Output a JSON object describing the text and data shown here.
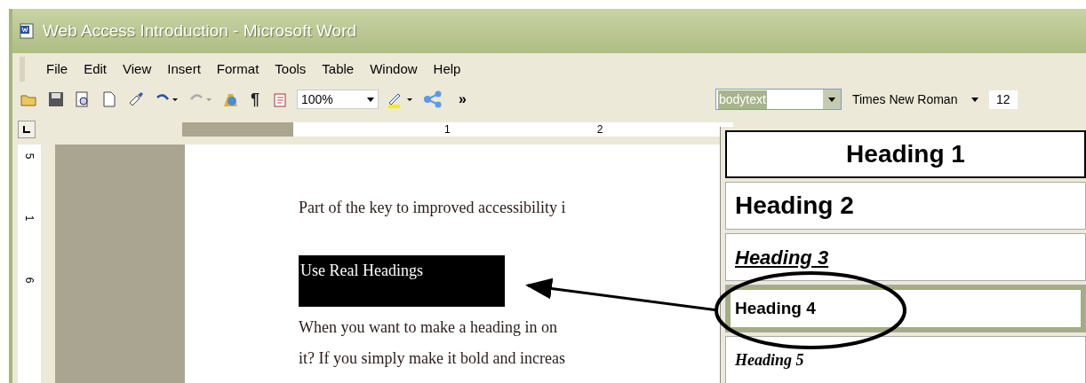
{
  "window": {
    "title": "Web Access Introduction - Microsoft Word"
  },
  "menu": [
    "File",
    "Edit",
    "View",
    "Insert",
    "Format",
    "Tools",
    "Table",
    "Window",
    "Help"
  ],
  "toolbar": {
    "pilcrow": "¶",
    "zoom": "100%",
    "overflow": "»",
    "style": "bodytext",
    "font": "Times New Roman",
    "size": "12"
  },
  "ruler": {
    "horizontal": [
      "1",
      "2"
    ],
    "vertical": [
      "5",
      "1",
      "6"
    ]
  },
  "document": {
    "intro": "Part of the key to improved accessibility i",
    "heading": "Use Real Headings",
    "lines": [
      "When you want to make a heading in on",
      "it? If you simply make it bold and increas"
    ]
  },
  "style_list": [
    {
      "label": "Heading 1",
      "kind": "h1",
      "hovered": false,
      "selected": true
    },
    {
      "label": "Heading 2",
      "kind": "h2",
      "hovered": false,
      "selected": false
    },
    {
      "label": "Heading 3",
      "kind": "h3",
      "hovered": false,
      "selected": false
    },
    {
      "label": "Heading 4",
      "kind": "h4",
      "hovered": true,
      "selected": false
    },
    {
      "label": "Heading 5",
      "kind": "h5",
      "hovered": false,
      "selected": false
    }
  ]
}
